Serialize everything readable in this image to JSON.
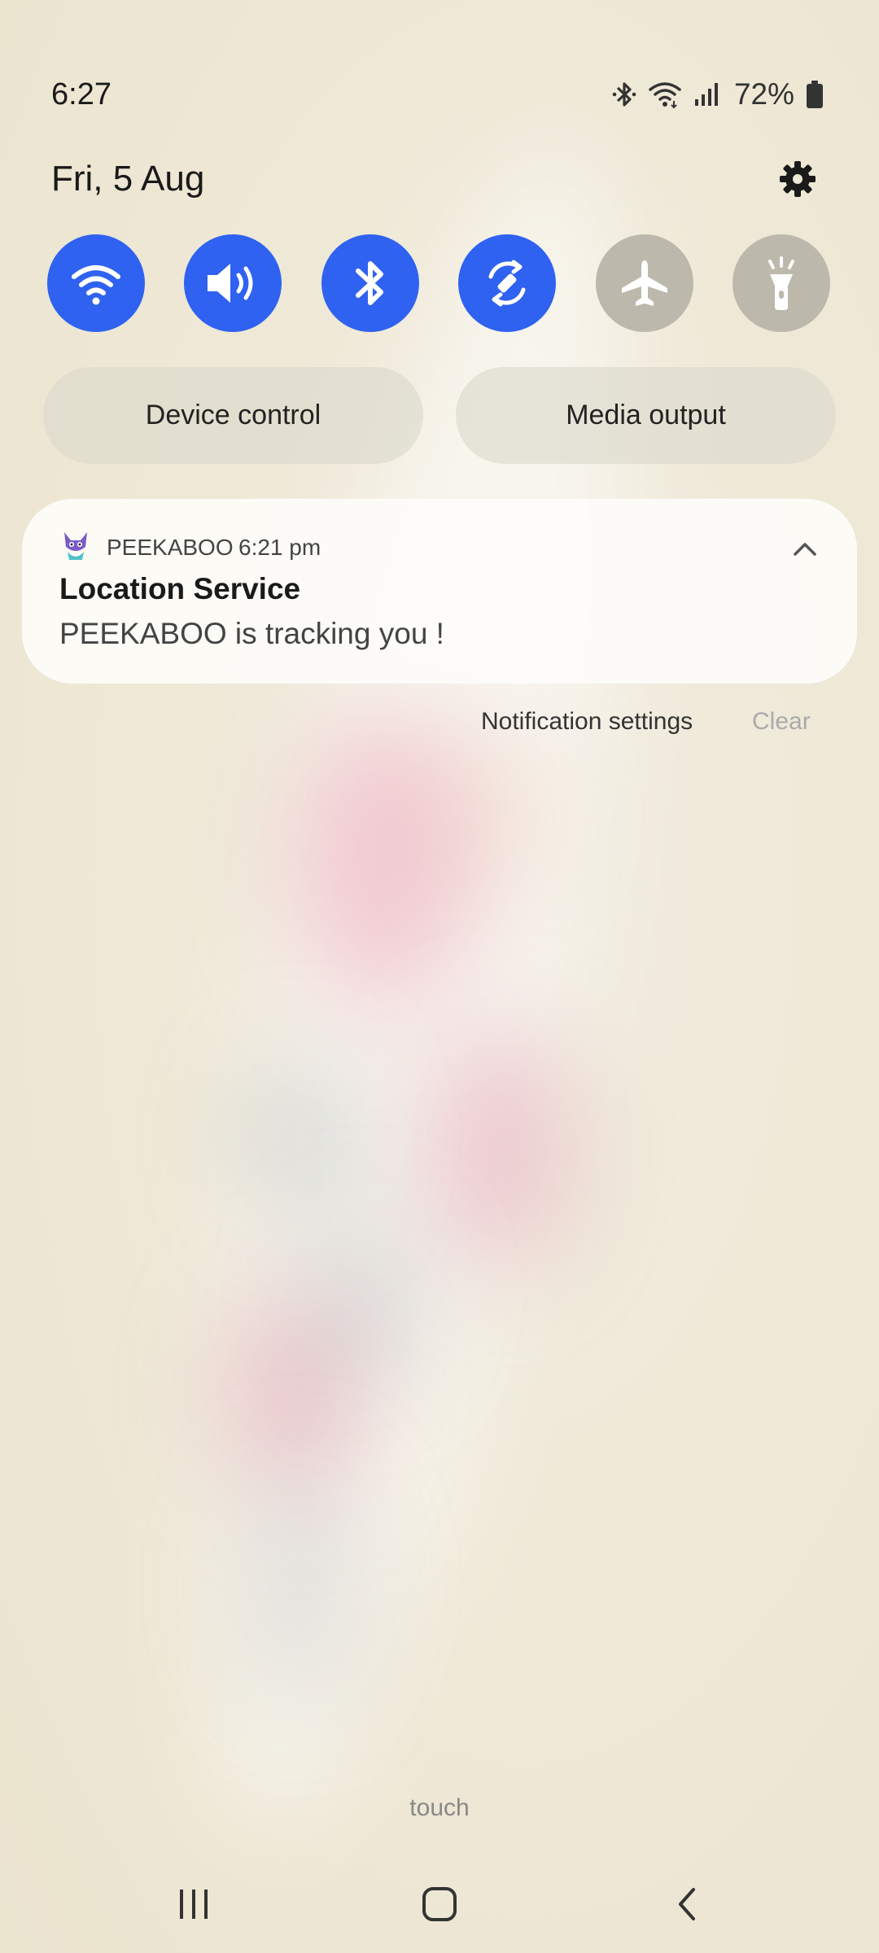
{
  "status_bar": {
    "time": "6:27",
    "battery_percent": "72%",
    "icons": [
      "bluetooth-icon",
      "wifi-icon",
      "signal-icon",
      "battery-icon"
    ]
  },
  "header": {
    "date": "Fri, 5 Aug",
    "settings_icon": "gear-icon"
  },
  "quick_toggles": [
    {
      "name": "wifi",
      "icon": "wifi-icon",
      "state": "on"
    },
    {
      "name": "sound",
      "icon": "speaker-icon",
      "state": "on"
    },
    {
      "name": "bluetooth",
      "icon": "bluetooth-icon",
      "state": "on"
    },
    {
      "name": "auto-rotate",
      "icon": "rotate-icon",
      "state": "on"
    },
    {
      "name": "airplane-mode",
      "icon": "airplane-icon",
      "state": "off"
    },
    {
      "name": "flashlight",
      "icon": "flashlight-icon",
      "state": "off"
    }
  ],
  "buttons": {
    "device_control": "Device control",
    "media_output": "Media output"
  },
  "notification": {
    "app_name": "PEEKABOO",
    "time": "6:21 pm",
    "title": "Location Service",
    "body": "PEEKABOO is tracking you !"
  },
  "notification_actions": {
    "settings": "Notification settings",
    "clear": "Clear"
  },
  "footer_text": "touch",
  "colors": {
    "toggle_on": "#2f62f0",
    "toggle_off": "#bcb8ab"
  }
}
